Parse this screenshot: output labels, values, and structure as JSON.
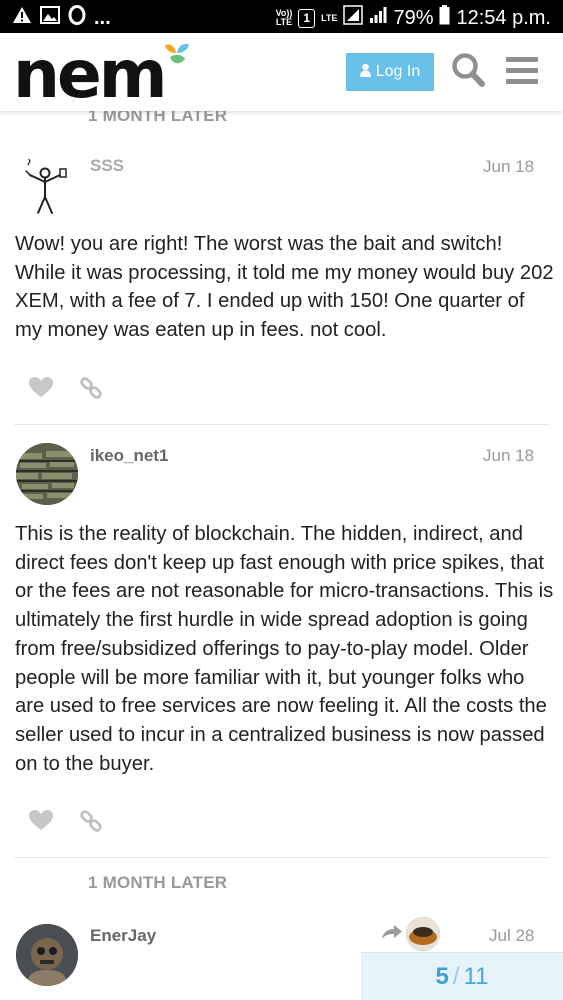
{
  "status_bar": {
    "left_icons": [
      "warning-icon",
      "image-icon",
      "opera-icon",
      "more-icon"
    ],
    "more_text": "...",
    "volte_text": "Vo))\nLTE",
    "sim_badge": "1",
    "lte_text": "LTE",
    "battery": "79%",
    "time": "12:54 p.m."
  },
  "header": {
    "logo_text": "nem",
    "login_label": "Log In",
    "accent_colors": [
      "#67c1e8",
      "#f6a623",
      "#67c17a"
    ]
  },
  "gaps": [
    {
      "label": "1 MONTH LATER"
    },
    {
      "label": "1 MONTH LATER"
    }
  ],
  "posts": [
    {
      "username": "SSS",
      "date": "Jun 18",
      "body": "Wow! you are right! The worst was the bait and switch! While it was processing, it told me my money would buy 202 XEM, with a fee of 7. I ended up with 150! One quarter of my money was eaten up in fees. not cool."
    },
    {
      "username": "ikeo_net1",
      "date": "Jun 18",
      "body": "This is the reality of blockchain. The hidden, indirect, and direct fees don't keep up fast enough with price spikes, that or the fees are not reasonable for micro-transactions. This is ultimately the first hurdle in wide spread adoption is going from free/subsidized offerings to pay-to-play model. Older people will be more familiar with it, but younger folks who are used to free services are now feeling it. All the costs the seller used to incur in a centralized business is now passed on to the buyer."
    },
    {
      "username": "EnerJay",
      "date": "Jul 28"
    }
  ],
  "progress": {
    "current": "5",
    "separator": "/",
    "total": "11"
  }
}
